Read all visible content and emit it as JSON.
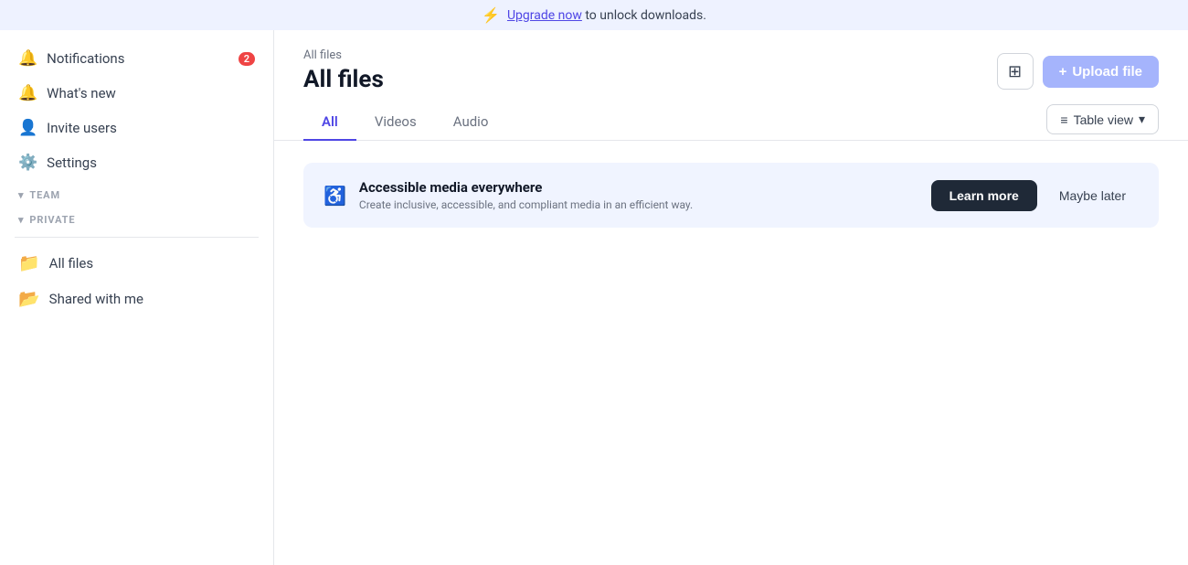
{
  "banner": {
    "icon": "⚡",
    "text_prefix": "",
    "link_text": "Upgrade now",
    "text_suffix": " to unlock downloads."
  },
  "sidebar": {
    "nav_items": [
      {
        "id": "notifications",
        "label": "Notifications",
        "icon": "🔔",
        "badge": "2"
      },
      {
        "id": "whats-new",
        "label": "What's new",
        "icon": "🔔",
        "badge": ""
      }
    ],
    "nav_items2": [
      {
        "id": "invite-users",
        "label": "Invite users",
        "icon": "👤"
      },
      {
        "id": "settings",
        "label": "Settings",
        "icon": "⚙️"
      }
    ],
    "sections": [
      {
        "id": "team",
        "label": "TEAM"
      },
      {
        "id": "private",
        "label": "PRIVATE"
      }
    ],
    "folders": [
      {
        "id": "all-files",
        "label": "All files",
        "icon": "📁"
      },
      {
        "id": "shared-with-me",
        "label": "Shared with me",
        "icon": "📂"
      }
    ]
  },
  "content": {
    "breadcrumb": "All files",
    "page_title": "All files",
    "header_actions": {
      "upload_icon": "+",
      "upload_label": "Upload file"
    },
    "tabs": [
      {
        "id": "all",
        "label": "All",
        "active": true
      },
      {
        "id": "videos",
        "label": "Videos",
        "active": false
      },
      {
        "id": "audio",
        "label": "Audio",
        "active": false
      }
    ],
    "table_view_label": "Table view",
    "info_card": {
      "icon": "♿",
      "title": "Accessible media everywhere",
      "description": "Create inclusive, accessible, and compliant media in an efficient way.",
      "learn_more_label": "Learn more",
      "maybe_later_label": "Maybe later"
    }
  }
}
